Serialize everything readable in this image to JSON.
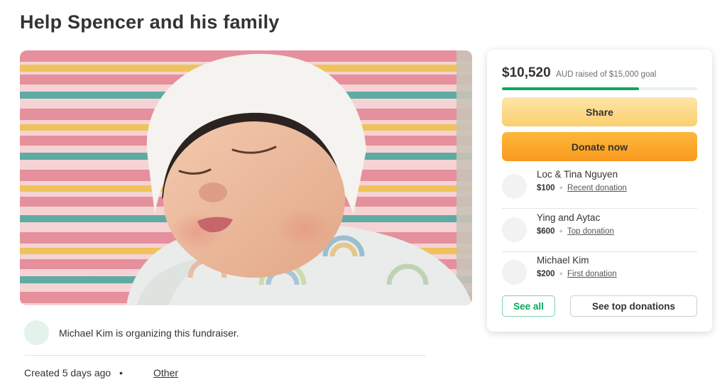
{
  "page": {
    "title": "Help Spencer and his family"
  },
  "organizer": {
    "text": "Michael Kim is organizing this fundraiser."
  },
  "meta": {
    "created": "Created 5 days ago",
    "separator": "•",
    "category": "Other"
  },
  "card": {
    "raised_amount": "$10,520",
    "raised_goal": "AUD raised of $15,000 goal",
    "progress_fraction": 0.7013,
    "share_label": "Share",
    "donate_label": "Donate now",
    "donations": [
      {
        "name": "Loc & Tina Nguyen",
        "amount": "$100",
        "label": "Recent donation"
      },
      {
        "name": "Ying and Aytac",
        "amount": "$600",
        "label": "Top donation"
      },
      {
        "name": "Michael Kim",
        "amount": "$200",
        "label": "First donation"
      }
    ],
    "see_all_label": "See all",
    "see_top_label": "See top donations"
  },
  "colors": {
    "accent_green": "#02a95c",
    "donate_orange": "#f89a1f",
    "share_yellow": "#fbcf6f"
  },
  "hero_image": {
    "subject": "sleeping-newborn-photo"
  }
}
